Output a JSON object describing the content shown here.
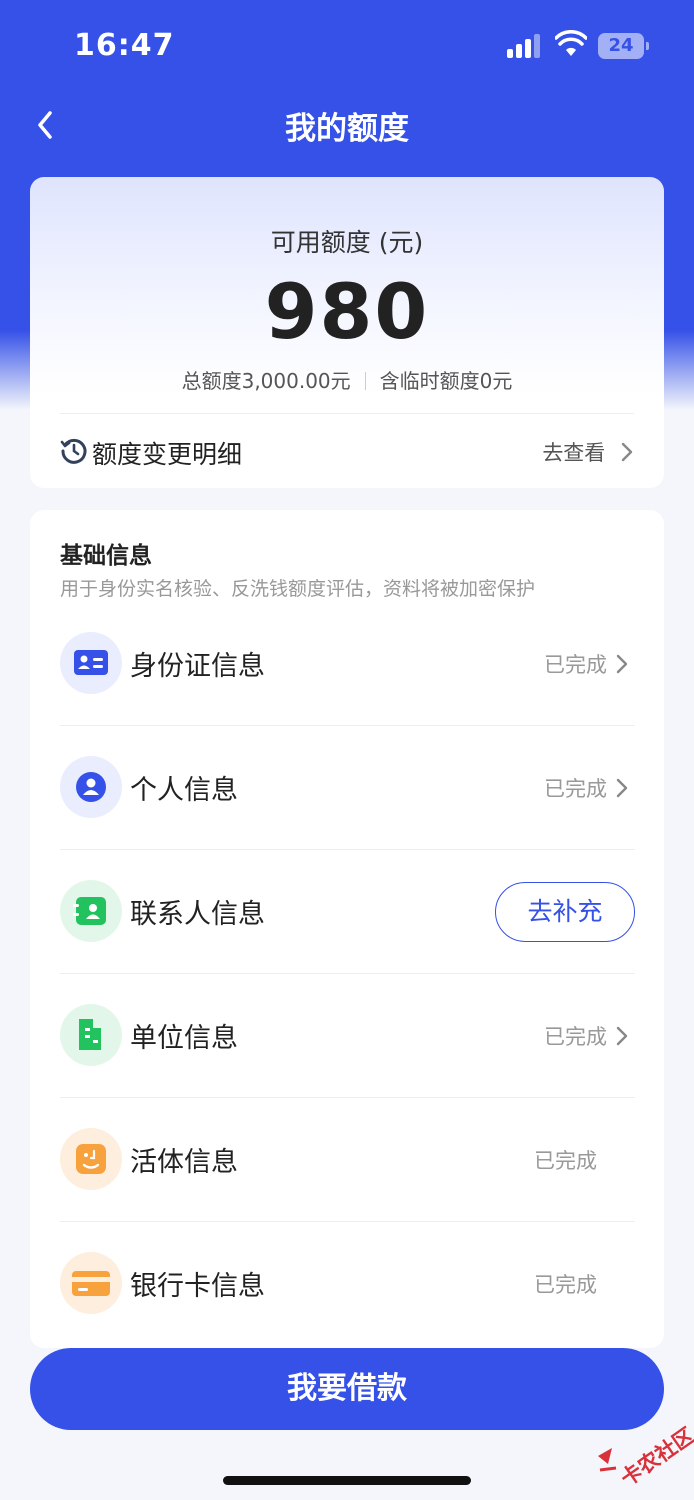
{
  "status_bar": {
    "time": "16:47",
    "battery": "24"
  },
  "nav": {
    "title": "我的额度"
  },
  "quota": {
    "label": "可用额度 (元)",
    "value": "980",
    "total": "总额度3,000.00元",
    "temp": "含临时额度0元",
    "history_label": "额度变更明细",
    "history_action": "去查看"
  },
  "basic_info": {
    "title": "基础信息",
    "subtitle": "用于身份实名核验、反洗钱额度评估，资料将被加密保护",
    "items": [
      {
        "label": "身份证信息",
        "status": "已完成"
      },
      {
        "label": "个人信息",
        "status": "已完成"
      },
      {
        "label": "联系人信息",
        "action": "去补充"
      },
      {
        "label": "单位信息",
        "status": "已完成"
      },
      {
        "label": "活体信息",
        "status": "已完成"
      },
      {
        "label": "银行卡信息",
        "status": "已完成"
      }
    ]
  },
  "cta": {
    "label": "我要借款"
  },
  "watermark": {
    "text": "卡农社区"
  },
  "colors": {
    "primary": "#3551e8",
    "green": "#22c35e",
    "orange": "#f7a23c"
  }
}
